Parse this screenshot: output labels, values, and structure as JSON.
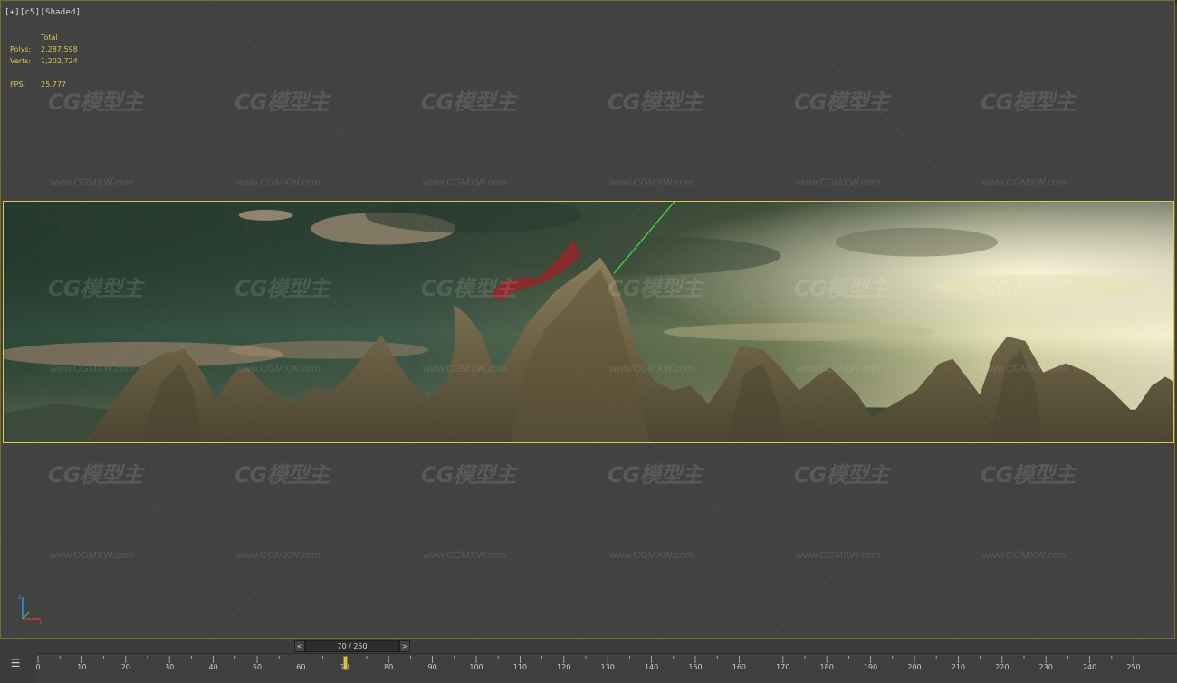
{
  "viewport": {
    "label": "[+][c5][Shaded]",
    "stats": {
      "header": "Total",
      "polys_label": "Polys:",
      "polys_value": "2,287,598",
      "verts_label": "Verts:",
      "verts_value": "1,202,724",
      "fps_label": "FPS:",
      "fps_value": "25.777"
    }
  },
  "watermark": {
    "logo": "CG模型主",
    "url": "www.CGMXW.com"
  },
  "time_slider": {
    "prev": "<",
    "next": ">",
    "position": "70 / 250",
    "current_frame": 70,
    "total_frames": 250
  },
  "trackbar": {
    "labels": [
      "0",
      "10",
      "20",
      "30",
      "40",
      "50",
      "60",
      "70",
      "80",
      "90",
      "100",
      "110",
      "120",
      "130",
      "140",
      "150",
      "160",
      "170",
      "180",
      "190",
      "200",
      "210",
      "220",
      "230",
      "240",
      "250"
    ]
  },
  "colors": {
    "frame_border": "#d8c94a",
    "stats_text": "#d8c94a",
    "key_marker": "#d6c24a"
  },
  "icons": {
    "trackbar_toggle": "curve-editor-icon",
    "gizmo": "axis-tripod-icon"
  }
}
